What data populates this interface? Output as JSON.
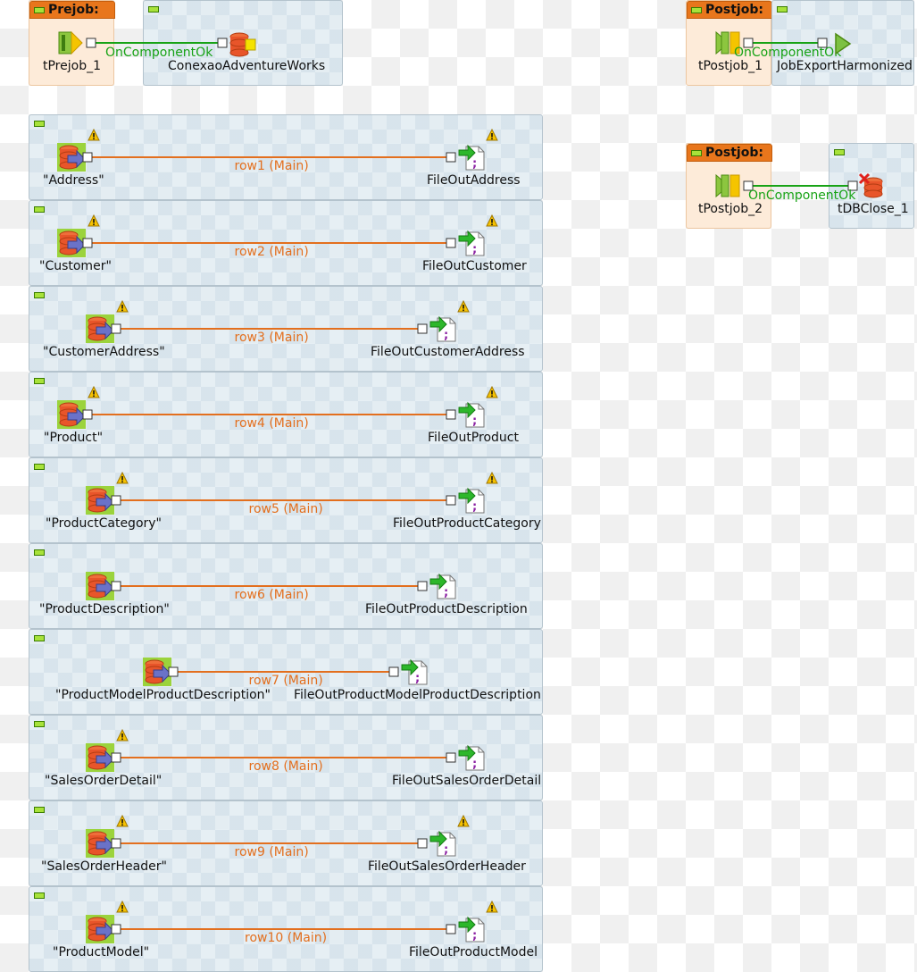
{
  "prejob": {
    "header": "Prejob:",
    "component": "tPrejob_1",
    "link": "OnComponentOk",
    "target": "ConexaoAdventureWorks"
  },
  "postjob1": {
    "header": "Postjob:",
    "component": "tPostjob_1",
    "link": "OnComponentOk",
    "target": "JobExportHarmonized"
  },
  "postjob2": {
    "header": "Postjob:",
    "component": "tPostjob_2",
    "link": "OnComponentOk",
    "target": "tDBClose_1"
  },
  "flows": [
    {
      "source": "\"Address\"",
      "link": "row1 (Main)",
      "target": "FileOutAddress"
    },
    {
      "source": "\"Customer\"",
      "link": "row2 (Main)",
      "target": "FileOutCustomer"
    },
    {
      "source": "\"CustomerAddress\"",
      "link": "row3 (Main)",
      "target": "FileOutCustomerAddress"
    },
    {
      "source": "\"Product\"",
      "link": "row4 (Main)",
      "target": "FileOutProduct"
    },
    {
      "source": "\"ProductCategory\"",
      "link": "row5 (Main)",
      "target": "FileOutProductCategory"
    },
    {
      "source": "\"ProductDescription\"",
      "link": "row6 (Main)",
      "target": "FileOutProductDescription"
    },
    {
      "source": "\"ProductModelProductDescription\"",
      "link": "row7 (Main)",
      "target": "FileOutProductModelProductDescription"
    },
    {
      "source": "\"SalesOrderDetail\"",
      "link": "row8 (Main)",
      "target": "FileOutSalesOrderDetail"
    },
    {
      "source": "\"SalesOrderHeader\"",
      "link": "row9 (Main)",
      "target": "FileOutSalesOrderHeader"
    },
    {
      "source": "\"ProductModel\"",
      "link": "row10 (Main)",
      "target": "FileOutProductModel"
    }
  ],
  "icons": {
    "collapse": "minus-icon",
    "warning": "warning-icon",
    "db_input": "database-input-icon",
    "file_output": "file-output-icon",
    "trigger": "trigger-icon",
    "run_job": "run-job-icon",
    "db_close": "database-close-icon"
  },
  "colors": {
    "main_link": "#e36f1e",
    "trigger_link": "#18a316",
    "subjob_header": "#e8761c",
    "subjob_bg": "#e2ecf2"
  }
}
